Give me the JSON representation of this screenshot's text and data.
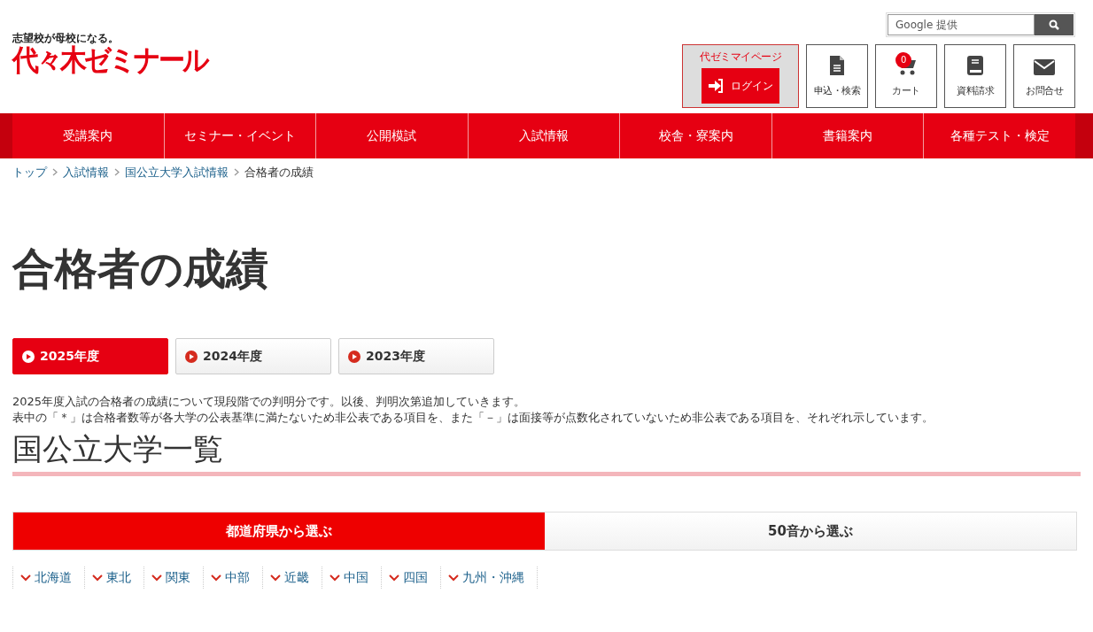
{
  "header": {
    "tagline": "志望校が母校になる。",
    "logo": "代々木ゼミナール",
    "search": {
      "placeholder": "Google 提供"
    },
    "mypage": {
      "label": "代ゼミマイページ",
      "login": "ログイン"
    },
    "tools": [
      {
        "kind": "document",
        "label": "申込・検索"
      },
      {
        "kind": "cart",
        "label": "カート",
        "badge": "0"
      },
      {
        "kind": "book",
        "label": "資料請求"
      },
      {
        "kind": "mail",
        "label": "お問合せ"
      }
    ]
  },
  "nav": [
    "受講案内",
    "セミナー・イベント",
    "公開模試",
    "入試情報",
    "校舎・寮案内",
    "書籍案内",
    "各種テスト・検定"
  ],
  "breadcrumb": {
    "links": [
      "トップ",
      "入試情報",
      "国公立大学入試情報"
    ],
    "current": "合格者の成績"
  },
  "title": "合格者の成績",
  "year_tabs": [
    {
      "label": "2025年度",
      "selected": true
    },
    {
      "label": "2024年度",
      "selected": false
    },
    {
      "label": "2023年度",
      "selected": false
    }
  ],
  "notes": [
    "2025年度入試の合格者の成績について現段階での判明分です。以後、判明次第追加していきます。",
    "表中の「＊」は合格者数等が各大学の公表基準に満たないため非公表である項目を、また「－」は面接等が点数化されていないため非公表である項目を、それぞれ示しています。"
  ],
  "section_title": "国公立大学一覧",
  "select_tabs": [
    {
      "label": "都道府県から選ぶ",
      "selected": true
    },
    {
      "label": "50音から選ぶ",
      "selected": false
    }
  ],
  "regions": [
    "北海道",
    "東北",
    "関東",
    "中部",
    "近畿",
    "中国",
    "四国",
    "九州・沖縄"
  ]
}
